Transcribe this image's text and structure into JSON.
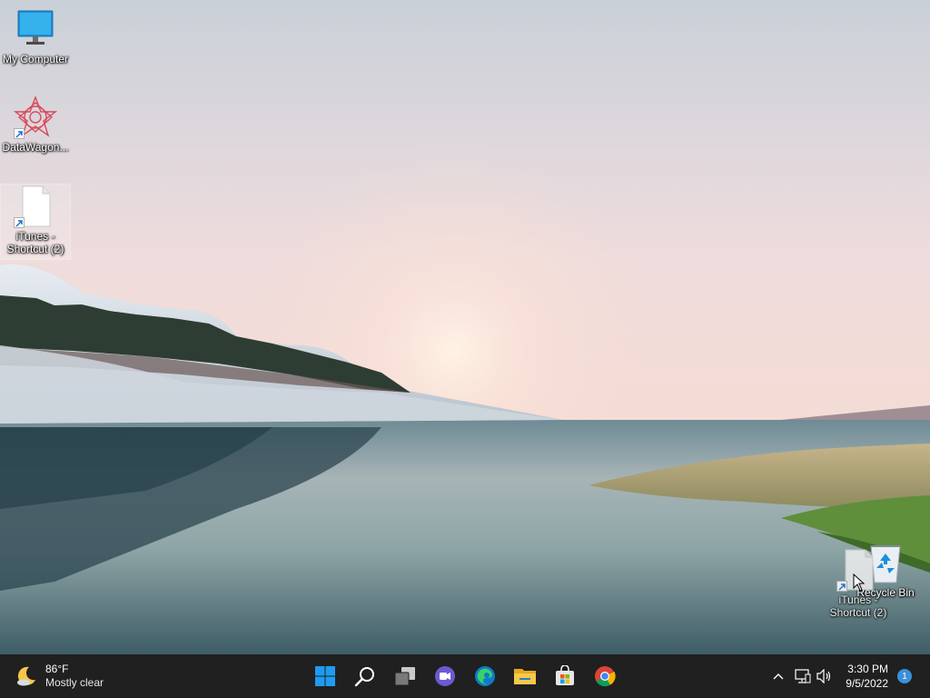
{
  "desktop": {
    "icons": [
      {
        "label": "My Computer",
        "icon": "monitor-icon"
      },
      {
        "label": "DataWagon...",
        "icon": "datawagon-app-icon"
      },
      {
        "label": "iTunes - Shortcut (2)",
        "icon": "file-shortcut-icon"
      },
      {
        "label": "Recycle Bin",
        "icon": "recycle-bin-icon"
      },
      {
        "label": "iTunes - Shortcut (2)",
        "icon": "file-shortcut-icon"
      }
    ]
  },
  "taskbar": {
    "weather": {
      "temp": "86°F",
      "condition": "Mostly clear",
      "icon": "moon-cloud-icon"
    },
    "apps": [
      {
        "name": "Start",
        "icon": "windows-logo-icon"
      },
      {
        "name": "Search",
        "icon": "search-icon"
      },
      {
        "name": "Task View",
        "icon": "task-view-icon"
      },
      {
        "name": "Chat",
        "icon": "teams-chat-icon"
      },
      {
        "name": "Microsoft Edge",
        "icon": "edge-icon"
      },
      {
        "name": "File Explorer",
        "icon": "folder-icon"
      },
      {
        "name": "Microsoft Store",
        "icon": "store-icon"
      },
      {
        "name": "Google Chrome",
        "icon": "chrome-icon"
      }
    ],
    "tray": {
      "time": "3:30 PM",
      "date": "9/5/2022",
      "notification_count": "1"
    }
  },
  "colors": {
    "taskbar_bg": "#202020",
    "accent": "#3b8fd9"
  }
}
